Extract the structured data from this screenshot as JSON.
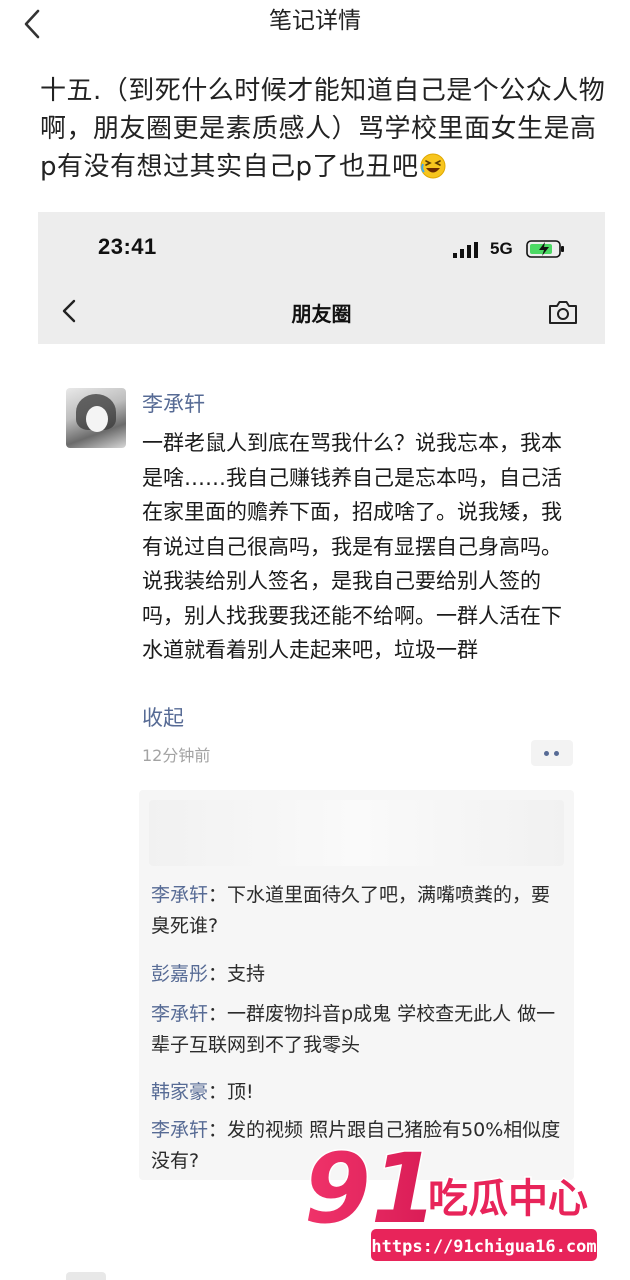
{
  "header": {
    "back_icon": "chevron-left-icon",
    "title": "笔记详情"
  },
  "post": {
    "text": "十五.（到死什么时候才能知道自己是个公众人物啊，朋友圈更是素质感人）骂学校里面女生是高p有没有想过其实自己p了也丑吧",
    "emoji": "rolling-on-floor-laughing-emoji"
  },
  "screenshot": {
    "status_bar": {
      "time": "23:41",
      "network": "5G",
      "signal_icon": "signal-bars-icon",
      "battery_icon": "battery-charging-icon"
    },
    "nav": {
      "back_icon": "chevron-left-icon",
      "title": "朋友圈",
      "camera_icon": "camera-icon"
    },
    "moment": {
      "author": "李承轩",
      "text": "一群老鼠人到底在骂我什么？说我忘本，我本是啥……我自己赚钱养自己是忘本吗，自己活在家里面的赡养下面，招成啥了。说我矮，我有说过自己很高吗，我是有显摆自己身高吗。说我装给别人签名，是我自己要给别人签的吗，别人找我要我还能不给啊。一群人活在下水道就看着别人走起来吧，垃圾一群",
      "collapse_label": "收起",
      "time": "12分钟前",
      "more_icon": "more-dots-icon"
    },
    "comments": [
      {
        "name": "李承轩",
        "sep": "：",
        "text": "下水道里面待久了吧，满嘴喷粪的，要臭死谁?"
      },
      {
        "name": "彭嘉彤",
        "sep": "：",
        "text": "支持"
      },
      {
        "name": "李承轩",
        "sep": "：",
        "text": "一群废物抖音p成鬼 学校查无此人 做一辈子互联网到不了我零头"
      },
      {
        "name": "韩家豪",
        "sep": "：",
        "text": "顶!"
      },
      {
        "name": "李承轩",
        "sep": "：",
        "text": "发的视频 照片跟自己猪脸有50%相似度没有?"
      }
    ]
  },
  "watermark": {
    "brand_number": "91",
    "brand_text": "吃瓜中心",
    "url": "https://91chigua16.com",
    "color": "#e8245a"
  }
}
